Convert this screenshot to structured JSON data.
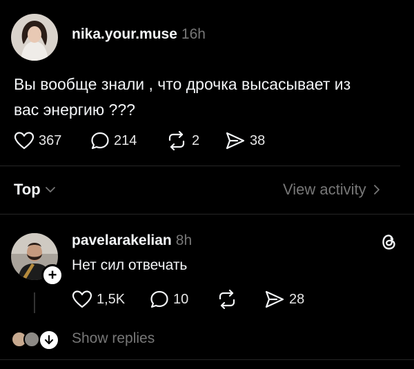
{
  "post": {
    "username": "nika.your.muse",
    "time": "16h",
    "text_line1": "Вы вообще знали , что дрочка высасывает из",
    "text_line2": "вас энергию ???",
    "likes": "367",
    "comments": "214",
    "reposts": "2",
    "shares": "38"
  },
  "sort_bar": {
    "sort_label": "Top",
    "view_activity": "View activity"
  },
  "reply": {
    "username": "pavelarakelian",
    "time": "8h",
    "text": "Нет сил отвечать",
    "likes": "1,5K",
    "comments": "10",
    "shares": "28",
    "show_replies": "Show replies"
  },
  "icons": {
    "like": "heart-icon",
    "comment": "comment-bubble-icon",
    "repost": "repost-icon",
    "share": "send-icon",
    "threads": "threads-logo-icon"
  }
}
